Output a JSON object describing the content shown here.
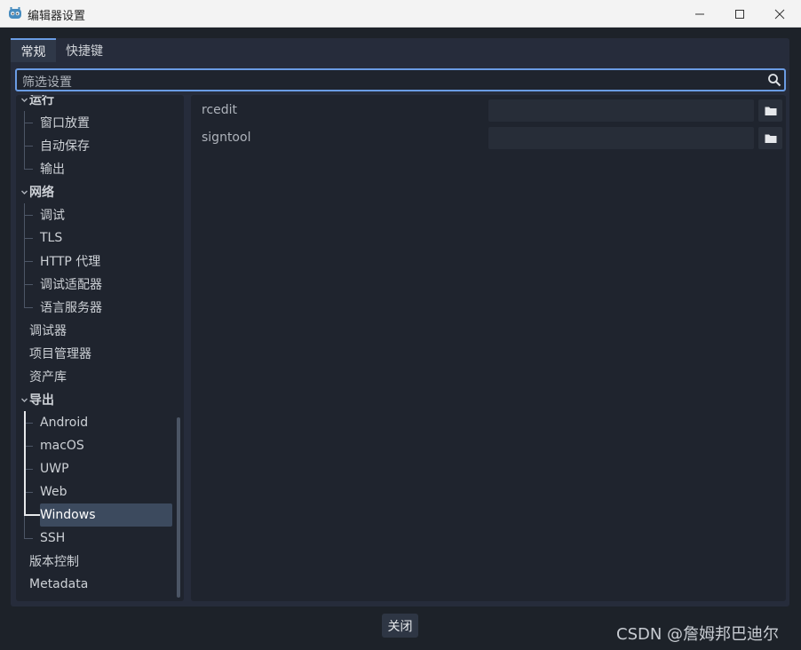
{
  "window": {
    "title": "编辑器设置",
    "icon": "godot-icon",
    "controls": [
      "minimize-icon",
      "maximize-icon",
      "close-icon"
    ]
  },
  "tabs": [
    {
      "label": "常规",
      "active": true
    },
    {
      "label": "快捷键",
      "active": false
    }
  ],
  "search": {
    "placeholder": "筛选设置",
    "icon": "search-icon"
  },
  "tree": {
    "items": [
      {
        "label": "运行",
        "level": 0,
        "expanded": true
      },
      {
        "label": "窗口放置",
        "level": 1
      },
      {
        "label": "自动保存",
        "level": 1
      },
      {
        "label": "输出",
        "level": 1
      },
      {
        "label": "网络",
        "level": 0,
        "expanded": true
      },
      {
        "label": "调试",
        "level": 1
      },
      {
        "label": "TLS",
        "level": 1
      },
      {
        "label": "HTTP 代理",
        "level": 1
      },
      {
        "label": "调试适配器",
        "level": 1
      },
      {
        "label": "语言服务器",
        "level": 1
      },
      {
        "label": "调试器",
        "level": 0
      },
      {
        "label": "项目管理器",
        "level": 0
      },
      {
        "label": "资产库",
        "level": 0
      },
      {
        "label": "导出",
        "level": 0,
        "expanded": true
      },
      {
        "label": "Android",
        "level": 1
      },
      {
        "label": "macOS",
        "level": 1
      },
      {
        "label": "UWP",
        "level": 1
      },
      {
        "label": "Web",
        "level": 1
      },
      {
        "label": "Windows",
        "level": 1,
        "selected": true
      },
      {
        "label": "SSH",
        "level": 1
      },
      {
        "label": "版本控制",
        "level": 0
      },
      {
        "label": "Metadata",
        "level": 0
      }
    ]
  },
  "properties": [
    {
      "label": "rcedit",
      "value": "",
      "button_icon": "folder-icon"
    },
    {
      "label": "signtool",
      "value": "",
      "button_icon": "folder-icon"
    }
  ],
  "footer": {
    "close_label": "关闭"
  },
  "watermark": "CSDN @詹姆邦巴迪尔",
  "colors": {
    "accent": "#6a9ce4",
    "panel": "#262c3b",
    "background": "#1d2229",
    "selected": "#3c4a5e"
  }
}
